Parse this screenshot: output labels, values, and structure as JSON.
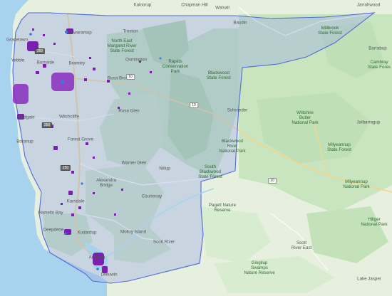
{
  "map": {
    "colors": {
      "water": "#a8d3ef",
      "land": "#e7f0de",
      "forest": "#bfe0b6",
      "forest_dark": "#a9d39e",
      "region_fill": "#9eaee0",
      "region_stroke": "#4f6bd6",
      "cluster": "#7a1fb0",
      "point_blue": "#2f7fe0",
      "road": "#ffffff",
      "highway": "#f4d58a"
    },
    "labels": [
      {
        "id": "kaloorup",
        "text": "Kaloorup",
        "kind": "town"
      },
      {
        "id": "chapman-hill",
        "text": "Chapman Hill",
        "kind": "town"
      },
      {
        "id": "walsall",
        "text": "Walsall",
        "kind": "town"
      },
      {
        "id": "jarrahwood",
        "text": "Jarrahwood",
        "kind": "town"
      },
      {
        "id": "baudin",
        "text": "Baudin",
        "kind": "town"
      },
      {
        "id": "millbrook",
        "text": "Millbrook\nState Forest",
        "kind": "park"
      },
      {
        "id": "barrabup",
        "text": "Barrabup",
        "kind": "town"
      },
      {
        "id": "cambray",
        "text": "Cambray\nState Fores",
        "kind": "park"
      },
      {
        "id": "cowaramup",
        "text": "Cowaramup",
        "kind": "town"
      },
      {
        "id": "treeton",
        "text": "Treeton",
        "kind": "town"
      },
      {
        "id": "north-east-margaret",
        "text": "North East\nMargaret River\nState Forest",
        "kind": "park"
      },
      {
        "id": "gracetown",
        "text": "Gracetown",
        "kind": "town"
      },
      {
        "id": "yebble",
        "text": "Yebble",
        "kind": "town"
      },
      {
        "id": "burnside",
        "text": "Burnside",
        "kind": "town"
      },
      {
        "id": "bramley",
        "text": "Bramley",
        "kind": "town"
      },
      {
        "id": "osmington",
        "text": "Osmington",
        "kind": "town"
      },
      {
        "id": "rapids",
        "text": "Rapids\nConservation\nPark",
        "kind": "park"
      },
      {
        "id": "blackwood-sf",
        "text": "Blackwood\nState Forest",
        "kind": "park"
      },
      {
        "id": "rosa-brook",
        "text": "Rosa Brook",
        "kind": "town"
      },
      {
        "id": "schroeder",
        "text": "Schroeder",
        "kind": "town"
      },
      {
        "id": "wiltshire",
        "text": "Wiltshire\nButler\nNational Park",
        "kind": "park"
      },
      {
        "id": "jalbarragup",
        "text": "Jalbarragup",
        "kind": "town"
      },
      {
        "id": "redgate",
        "text": "Redgate",
        "kind": "town"
      },
      {
        "id": "witchcliffe",
        "text": "Witchcliffe",
        "kind": "town"
      },
      {
        "id": "rosa-glen",
        "text": "Rosa Glen",
        "kind": "town"
      },
      {
        "id": "boranup",
        "text": "Boranup",
        "kind": "town"
      },
      {
        "id": "forest-grove",
        "text": "Forest Grove",
        "kind": "town"
      },
      {
        "id": "blackwood-river",
        "text": "Blackwood\nRiver\nNational Park",
        "kind": "park"
      },
      {
        "id": "milyeannup-sf",
        "text": "Milyeannup\nState Forest",
        "kind": "park"
      },
      {
        "id": "warner-glen",
        "text": "Warner Glen",
        "kind": "town"
      },
      {
        "id": "nillup",
        "text": "Nillup",
        "kind": "town"
      },
      {
        "id": "south-blackwood",
        "text": "South\nBlackwood\nState Forest",
        "kind": "park"
      },
      {
        "id": "milyeannup-np",
        "text": "Milyeannup\nNational Park",
        "kind": "park"
      },
      {
        "id": "alexandra-bridge",
        "text": "Alexandra\nBridge",
        "kind": "town"
      },
      {
        "id": "courtenay",
        "text": "Courtenay",
        "kind": "town"
      },
      {
        "id": "karridale",
        "text": "Karridale",
        "kind": "town"
      },
      {
        "id": "pagett",
        "text": "Pagett Nature\nReserve",
        "kind": "park"
      },
      {
        "id": "hamelin-bay",
        "text": "Hamelin Bay",
        "kind": "town"
      },
      {
        "id": "hillger",
        "text": "Hillger\nNational Park",
        "kind": "park"
      },
      {
        "id": "deepdene",
        "text": "Deepdene",
        "kind": "town"
      },
      {
        "id": "kudardup",
        "text": "Kudardup",
        "kind": "town"
      },
      {
        "id": "molloy-island",
        "text": "Molloy Island",
        "kind": "town"
      },
      {
        "id": "scott-river",
        "text": "Scott River",
        "kind": "town"
      },
      {
        "id": "scott-river-east",
        "text": "Scott\nRiver East",
        "kind": "town"
      },
      {
        "id": "augusta",
        "text": "Augusta",
        "kind": "town"
      },
      {
        "id": "gingilup",
        "text": "Gingilup\nSwamps\nNature Reserve",
        "kind": "park"
      },
      {
        "id": "leeuwin",
        "text": "Leeuwin",
        "kind": "town"
      },
      {
        "id": "lake-jasper",
        "text": "Lake Jasper",
        "kind": "town"
      }
    ],
    "shields": [
      {
        "id": "r250-a",
        "text": "250",
        "style": "sq"
      },
      {
        "id": "r250-b",
        "text": "250",
        "style": "sq"
      },
      {
        "id": "r250-c",
        "text": "250",
        "style": "sq"
      },
      {
        "id": "r10-a",
        "text": "10",
        "style": "plain"
      },
      {
        "id": "r10-b",
        "text": "10",
        "style": "plain"
      },
      {
        "id": "r10-c",
        "text": "10",
        "style": "plain"
      }
    ]
  }
}
